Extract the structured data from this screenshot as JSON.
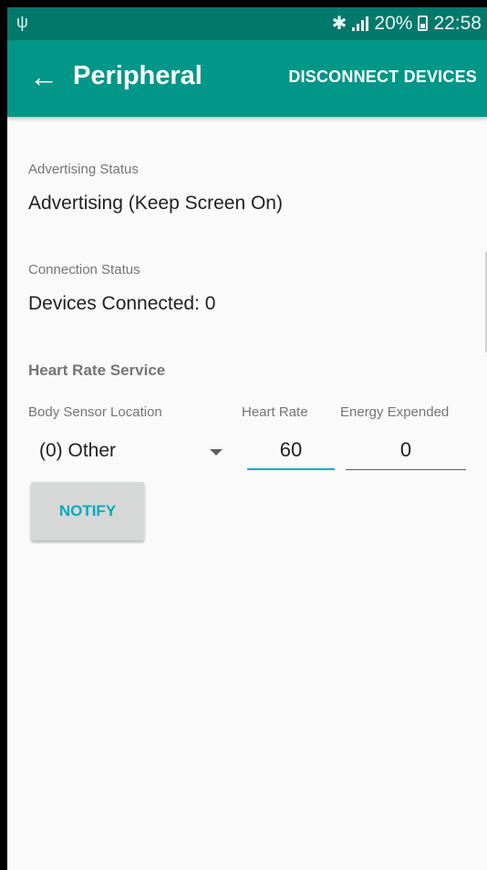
{
  "status_bar": {
    "usb_icon": "usb-icon",
    "bluetooth_icon": "bluetooth-icon",
    "signal_icon": "signal-icon",
    "battery_text": "20%",
    "battery_icon": "battery-charging-icon",
    "time": "22:58"
  },
  "app_bar": {
    "back_icon": "arrow-back-icon",
    "title": "Peripheral",
    "action_label": "DISCONNECT DEVICES",
    "color": "#009688"
  },
  "advertising": {
    "label": "Advertising Status",
    "value": "Advertising (Keep Screen On)"
  },
  "connection": {
    "label": "Connection Status",
    "value": "Devices Connected: 0"
  },
  "heart_rate_service": {
    "title": "Heart Rate Service",
    "body_sensor_label": "Body Sensor Location",
    "body_sensor_value": "(0) Other",
    "heart_rate_label": "Heart Rate",
    "heart_rate_value": "60",
    "energy_label": "Energy Expended",
    "energy_value": "0",
    "notify_label": "NOTIFY",
    "accent": "#00acc1"
  }
}
